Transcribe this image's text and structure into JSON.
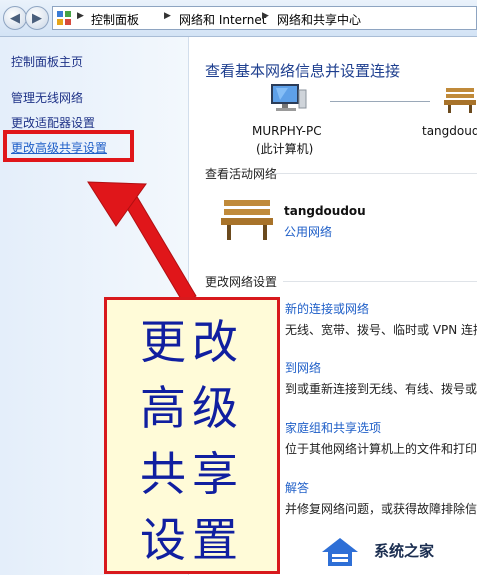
{
  "address_bar": {
    "breadcrumbs": [
      "控制面板",
      "网络和 Internet",
      "网络和共享中心"
    ]
  },
  "sidebar": {
    "items": [
      {
        "label": "控制面板主页"
      },
      {
        "label": "管理无线网络"
      },
      {
        "label": "更改适配器设置"
      },
      {
        "label": "更改高级共享设置"
      }
    ]
  },
  "main": {
    "heading": "查看基本网络信息并设置连接",
    "computer": {
      "name": "MURPHY-PC",
      "sub": "(此计算机)"
    },
    "network_right": {
      "name": "tangdoudou"
    },
    "active_section": "查看活动网络",
    "active_network": {
      "name": "tangdoudou",
      "type": "公用网络"
    },
    "change_section": "更改网络设置",
    "tasks": [
      {
        "link": "新的连接或网络",
        "desc": "无线、宽带、拨号、临时或 VPN 连接"
      },
      {
        "link": "到网络",
        "desc": "到或重新连接到无线、有线、拨号或"
      },
      {
        "link": "家庭组和共享选项",
        "desc": "位于其他网络计算机上的文件和打印"
      },
      {
        "link": "解答",
        "desc": "并修复网络问题，或获得故障排除信"
      }
    ]
  },
  "callout": {
    "lines": [
      "更改",
      "高级",
      "共享",
      "设置"
    ]
  },
  "watermark": {
    "text": "系统之家"
  },
  "colors": {
    "accent_red": "#e0161a",
    "link_blue": "#1f5fc8",
    "callout_text": "#101fa0",
    "callout_bg": "#fffbd8"
  }
}
